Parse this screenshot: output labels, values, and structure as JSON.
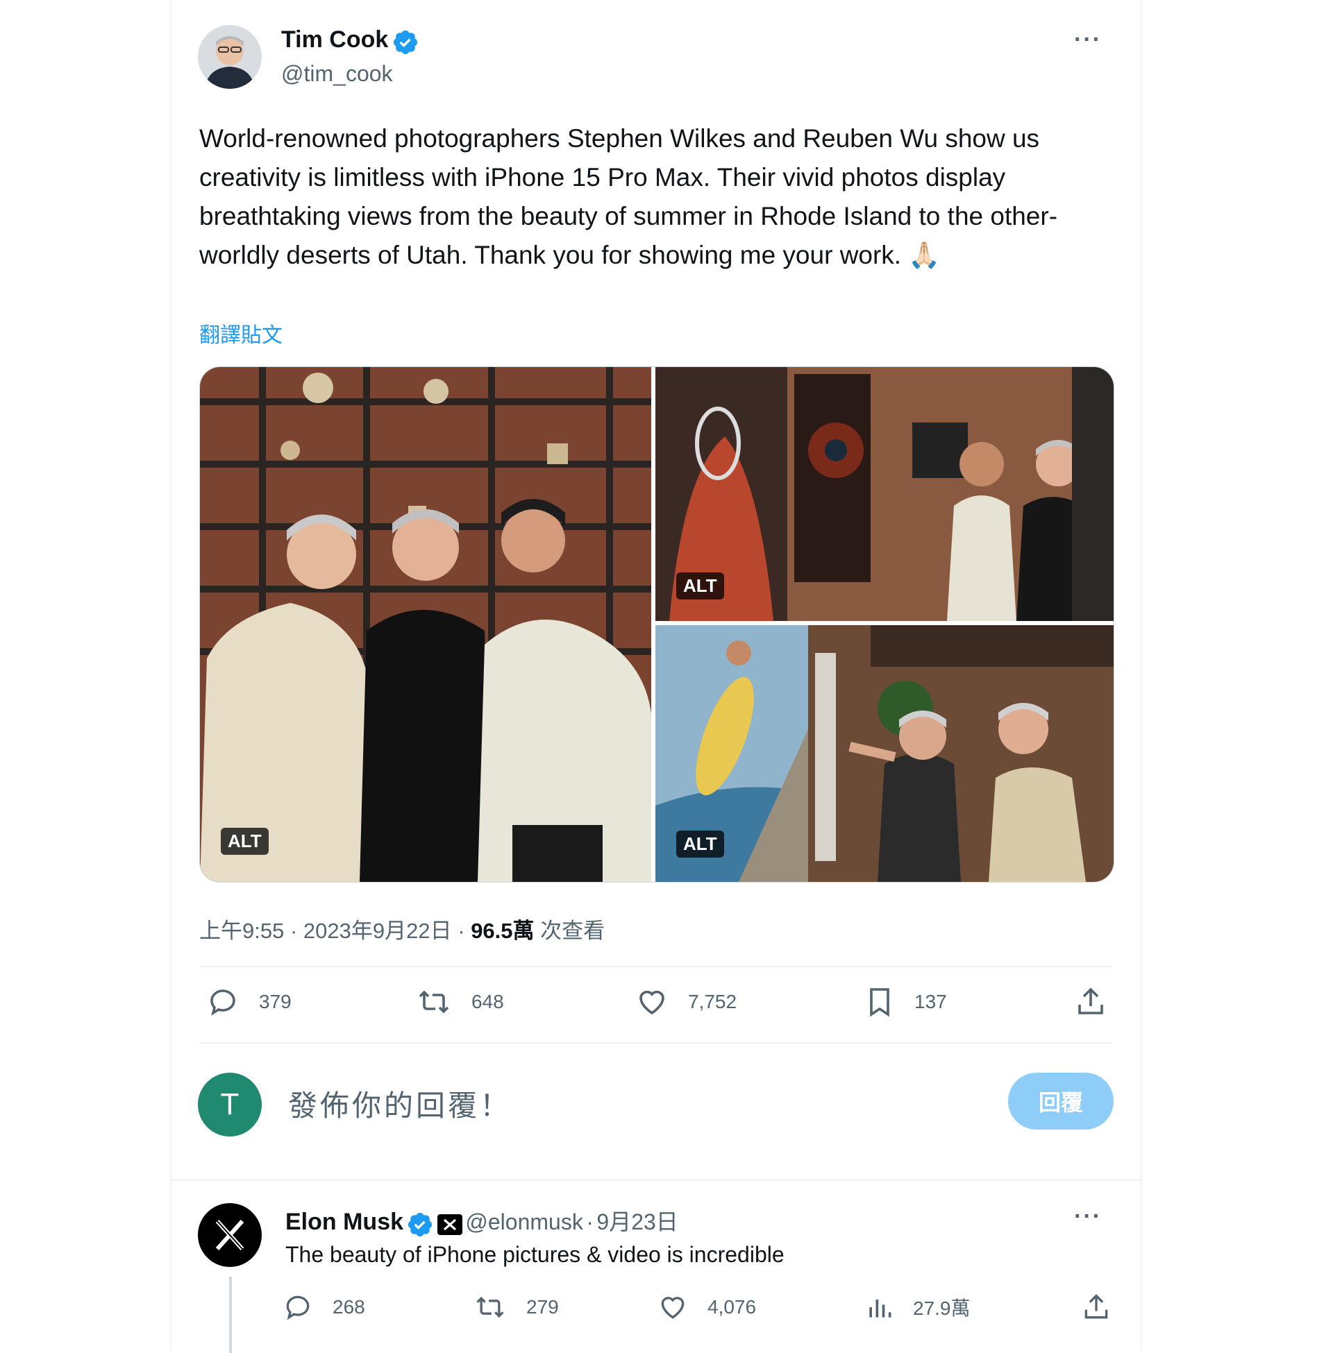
{
  "tweet": {
    "author_name": "Tim Cook",
    "author_handle": "@tim_cook",
    "more_label": "···",
    "text": "World-renowned photographers Stephen Wilkes and Reuben Wu show us creativity is limitless with iPhone 15 Pro Max. Their vivid photos display breathtaking views from the beauty of summer in Rhode Island to the other-worldly deserts of Utah. Thank you for showing me your work. 🙏🏻",
    "translate_label": "翻譯貼文",
    "alt_label": "ALT",
    "time": "上午9:55",
    "date": "2023年9月22日",
    "views_count": "96.5萬",
    "views_label": "次查看",
    "separator": "·",
    "stats": {
      "replies": "379",
      "retweets": "648",
      "likes": "7,752",
      "bookmarks": "137"
    }
  },
  "composer": {
    "avatar_letter": "T",
    "placeholder": "發佈你的回覆！",
    "reply_button": "回覆"
  },
  "reply": {
    "author_name": "Elon Musk",
    "author_handle": "@elonmusk",
    "separator": "·",
    "date": "9月23日",
    "more_label": "···",
    "text": "The beauty of iPhone pictures & video is incredible",
    "stats": {
      "replies": "268",
      "retweets": "279",
      "likes": "4,076",
      "views": "27.9萬"
    }
  },
  "colors": {
    "accent": "#1d9bf0",
    "secondary_text": "#536471",
    "composer_avatar": "#1f8a70",
    "reply_button_disabled": "#8ecdf8"
  }
}
